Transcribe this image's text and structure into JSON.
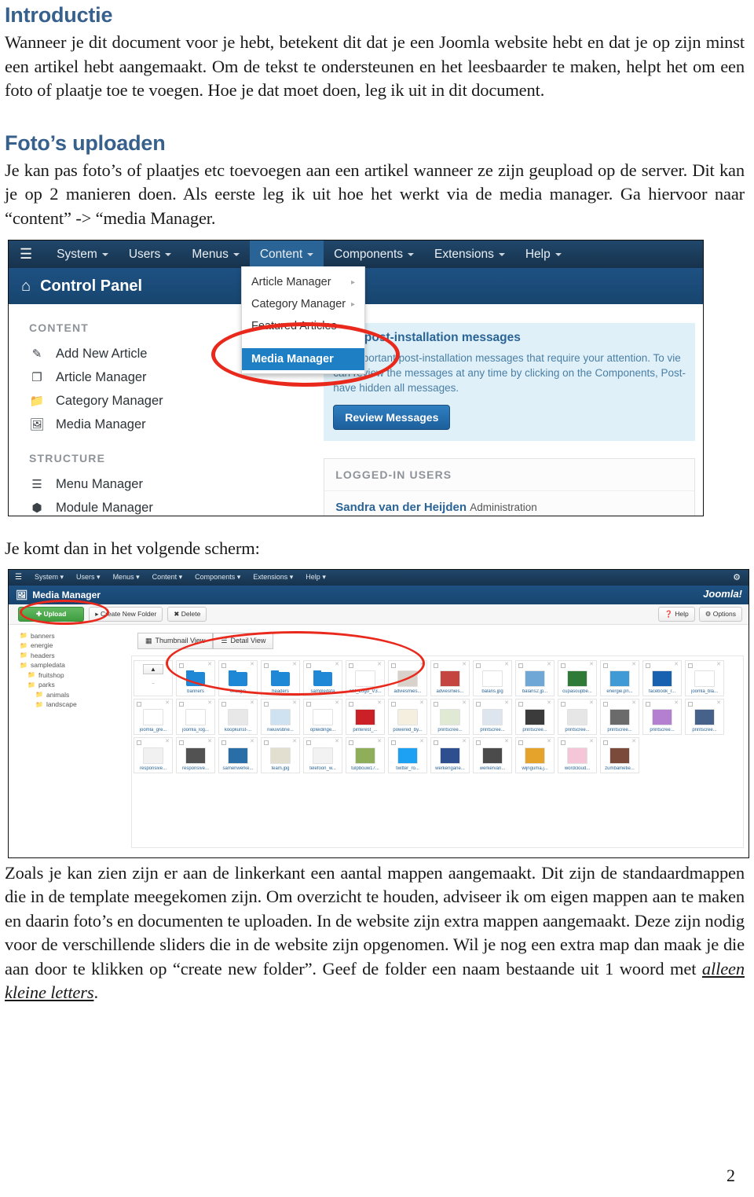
{
  "document": {
    "page_number": "2",
    "accent_heading_color": "#37618c",
    "highlight_color": "#e8291c"
  },
  "intro": {
    "heading": "Introductie",
    "paragraph": "Wanneer je dit document voor je hebt, betekent dit dat je een Joomla website hebt en dat je op zijn minst een artikel hebt aangemaakt.  Om de tekst te ondersteunen en het leesbaarder te maken, helpt het om een foto of plaatje toe te voegen. Hoe je dat moet doen, leg ik uit in dit document."
  },
  "uploaden": {
    "heading": "Foto’s uploaden",
    "paragraph": "Je kan pas foto’s of plaatjes etc toevoegen aan een artikel wanneer ze zijn geupload op de server. Dit kan je op 2 manieren doen. Als eerste leg ik uit hoe het werkt via de media manager. Ga hiervoor naar “content” -> “media Manager."
  },
  "caption_next": "Je komt dan in het volgende scherm:",
  "closing": {
    "paragraph_part1": "Zoals je kan zien zijn er aan de linkerkant een aantal mappen aangemaakt. Dit zijn de standaardmappen die in de template meegekomen zijn. Om overzicht te houden, adviseer ik om eigen mappen aan te maken en daarin foto’s en documenten te uploaden. In de website zijn extra mappen aangemaakt. Deze zijn nodig voor de verschillende sliders die in de website zijn opgenomen. Wil je nog een extra map dan maak je die aan door te klikken op “create new folder”. Geef de folder een naam bestaande uit 1 woord met ",
    "emphasis": "alleen kleine letters",
    "paragraph_part2": "."
  },
  "control_panel_shot": {
    "menubar": [
      {
        "label": "System",
        "has_caret": true,
        "active": false
      },
      {
        "label": "Users",
        "has_caret": true,
        "active": false
      },
      {
        "label": "Menus",
        "has_caret": true,
        "active": false
      },
      {
        "label": "Content",
        "has_caret": true,
        "active": true
      },
      {
        "label": "Components",
        "has_caret": true,
        "active": false
      },
      {
        "label": "Extensions",
        "has_caret": true,
        "active": false
      },
      {
        "label": "Help",
        "has_caret": true,
        "active": false
      }
    ],
    "page_title": "Control Panel",
    "content_dropdown": [
      {
        "label": "Article Manager",
        "submenu": true,
        "selected": false
      },
      {
        "label": "Category Manager",
        "submenu": true,
        "selected": false
      },
      {
        "label": "Featured Articles",
        "submenu": false,
        "selected": false
      },
      {
        "label": "Media Manager",
        "submenu": false,
        "selected": true
      }
    ],
    "sidebar": {
      "group_content_label": "CONTENT",
      "content_items": [
        {
          "label": "Add New Article",
          "icon": "pencil-icon"
        },
        {
          "label": "Article Manager",
          "icon": "copy-icon"
        },
        {
          "label": "Category Manager",
          "icon": "folder-icon"
        },
        {
          "label": "Media Manager",
          "icon": "image-icon"
        }
      ],
      "group_structure_label": "STRUCTURE",
      "structure_items": [
        {
          "label": "Menu Manager",
          "icon": "list-icon"
        },
        {
          "label": "Module Manager",
          "icon": "cube-icon"
        }
      ]
    },
    "message_panel": {
      "title": "have post-installation messages",
      "line1": "are important post-installation messages that require your attention. To vie",
      "line2": "can review the messages at any time by clicking on the Components, Post-",
      "line3": "have hidden all messages.",
      "button_label": "Review Messages"
    },
    "logged_in_users": {
      "header": "LOGGED-IN USERS",
      "user_name": "Sandra van der Heijden",
      "user_role": "Administration"
    }
  },
  "media_manager_shot": {
    "menubar": [
      "System",
      "Users",
      "Menus",
      "Content",
      "Components",
      "Extensions",
      "Help"
    ],
    "page_title": "Media Manager",
    "brand": "Joomla!",
    "toolbar": {
      "upload_label": "Upload",
      "create_folder_label": "Create New Folder",
      "delete_label": "Delete",
      "help_label": "Help",
      "options_label": "Options"
    },
    "view_tabs": [
      {
        "label": "Thumbnail View",
        "active": true
      },
      {
        "label": "Detail View",
        "active": false
      }
    ],
    "folder_tree": [
      {
        "label": "banners",
        "depth": 0
      },
      {
        "label": "energie",
        "depth": 0
      },
      {
        "label": "headers",
        "depth": 0
      },
      {
        "label": "sampledata",
        "depth": 0
      },
      {
        "label": "fruitshop",
        "depth": 1
      },
      {
        "label": "parks",
        "depth": 1
      },
      {
        "label": "animals",
        "depth": 2
      },
      {
        "label": "landscape",
        "depth": 2
      }
    ],
    "files": [
      {
        "caption": "..",
        "kind": "up"
      },
      {
        "caption": "banners",
        "kind": "folder"
      },
      {
        "caption": "energie",
        "kind": "folder"
      },
      {
        "caption": "headers",
        "kind": "folder"
      },
      {
        "caption": "sampledata",
        "kind": "folder"
      },
      {
        "caption": "AM_Logo_V3...",
        "kind": "image",
        "color": "#ffffff"
      },
      {
        "caption": "adviesmies...",
        "kind": "image",
        "color": "#d9d2cb"
      },
      {
        "caption": "adviesmies...",
        "kind": "image",
        "color": "#c4453f"
      },
      {
        "caption": "balans.jpg",
        "kind": "image",
        "color": "#ffffff"
      },
      {
        "caption": "balans2.jp...",
        "kind": "image",
        "color": "#6fa8d6"
      },
      {
        "caption": "cupasoupbe...",
        "kind": "image",
        "color": "#2f7a37"
      },
      {
        "caption": "energie.pn...",
        "kind": "image",
        "color": "#3f9ad6"
      },
      {
        "caption": "facebook_r...",
        "kind": "image",
        "color": "#1761b0"
      },
      {
        "caption": "joomla_bla...",
        "kind": "image",
        "color": "#ffffff"
      },
      {
        "caption": "joomla_gre...",
        "kind": "image",
        "color": "#ffffff"
      },
      {
        "caption": "joomla_log...",
        "kind": "image",
        "color": "#ffffff"
      },
      {
        "caption": "koopkunst-...",
        "kind": "image",
        "color": "#e8e8e8"
      },
      {
        "caption": "nieuwsbrie...",
        "kind": "image",
        "color": "#cfe2f2"
      },
      {
        "caption": "opleidinge...",
        "kind": "image",
        "color": "#ffffff"
      },
      {
        "caption": "pinterest_...",
        "kind": "image",
        "color": "#cb2027"
      },
      {
        "caption": "powered_by...",
        "kind": "image",
        "color": "#f5efe0"
      },
      {
        "caption": "printscree...",
        "kind": "image",
        "color": "#dfe9d4"
      },
      {
        "caption": "printscree...",
        "kind": "image",
        "color": "#dde6ee"
      },
      {
        "caption": "printscree...",
        "kind": "image",
        "color": "#3b3b3b"
      },
      {
        "caption": "printscree...",
        "kind": "image",
        "color": "#e6e6e6"
      },
      {
        "caption": "printscree...",
        "kind": "image",
        "color": "#6b6b6b"
      },
      {
        "caption": "printscree...",
        "kind": "image",
        "color": "#b47fd0"
      },
      {
        "caption": "printscree...",
        "kind": "image",
        "color": "#46618a"
      },
      {
        "caption": "responsive...",
        "kind": "image",
        "color": "#f1f1f1"
      },
      {
        "caption": "responsive...",
        "kind": "image",
        "color": "#525252"
      },
      {
        "caption": "samenwerke...",
        "kind": "image",
        "color": "#2a6ea8"
      },
      {
        "caption": "team.jpg",
        "kind": "image",
        "color": "#e3dfd0"
      },
      {
        "caption": "telefoon_w...",
        "kind": "image",
        "color": "#f2f2f2"
      },
      {
        "caption": "tulpbouw17...",
        "kind": "image",
        "color": "#8fae5a"
      },
      {
        "caption": "twitter_ro...",
        "kind": "image",
        "color": "#1da1f2"
      },
      {
        "caption": "werkengane...",
        "kind": "image",
        "color": "#2d4f8f"
      },
      {
        "caption": "werkervari...",
        "kind": "image",
        "color": "#4b4b4b"
      },
      {
        "caption": "wijnguma.j...",
        "kind": "image",
        "color": "#e6a32c"
      },
      {
        "caption": "wordcloud...",
        "kind": "image",
        "color": "#f4c6d8"
      },
      {
        "caption": "zumbametie...",
        "kind": "image",
        "color": "#7b4a3a"
      }
    ]
  }
}
